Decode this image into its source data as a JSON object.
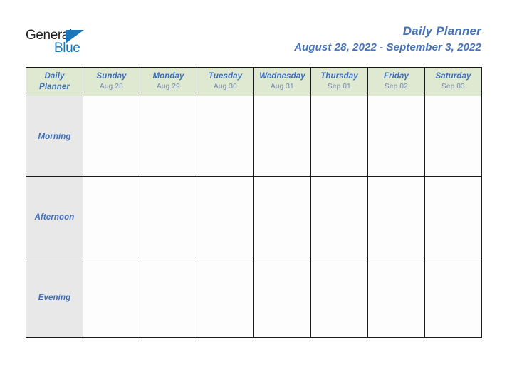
{
  "brand": {
    "word_one": "General",
    "word_two": "Blue",
    "mark": "blue-triangle-flag",
    "color_dark": "#231f20",
    "color_blue": "#1b75bb"
  },
  "header": {
    "title": "Daily Planner",
    "date_range": "August 28, 2022 - September 3, 2022",
    "title_color": "#4472b8"
  },
  "table": {
    "corner": {
      "line_one": "Daily",
      "line_two": "Planner"
    },
    "header_bg": "#dfe9d2",
    "label_bg": "#e8e8e8",
    "cell_bg": "#fdfdfd",
    "border_color": "#1a1a1a",
    "day_color": "#3e6fb5",
    "date_color": "#7189b8",
    "columns": [
      {
        "day": "Sunday",
        "date": "Aug 28"
      },
      {
        "day": "Monday",
        "date": "Aug 29"
      },
      {
        "day": "Tuesday",
        "date": "Aug 30"
      },
      {
        "day": "Wednesday",
        "date": "Aug 31"
      },
      {
        "day": "Thursday",
        "date": "Sep 01"
      },
      {
        "day": "Friday",
        "date": "Sep 02"
      },
      {
        "day": "Saturday",
        "date": "Sep 03"
      }
    ],
    "rows": [
      {
        "label": "Morning",
        "entries": [
          "",
          "",
          "",
          "",
          "",
          "",
          ""
        ]
      },
      {
        "label": "Afternoon",
        "entries": [
          "",
          "",
          "",
          "",
          "",
          "",
          ""
        ]
      },
      {
        "label": "Evening",
        "entries": [
          "",
          "",
          "",
          "",
          "",
          "",
          ""
        ]
      }
    ]
  }
}
